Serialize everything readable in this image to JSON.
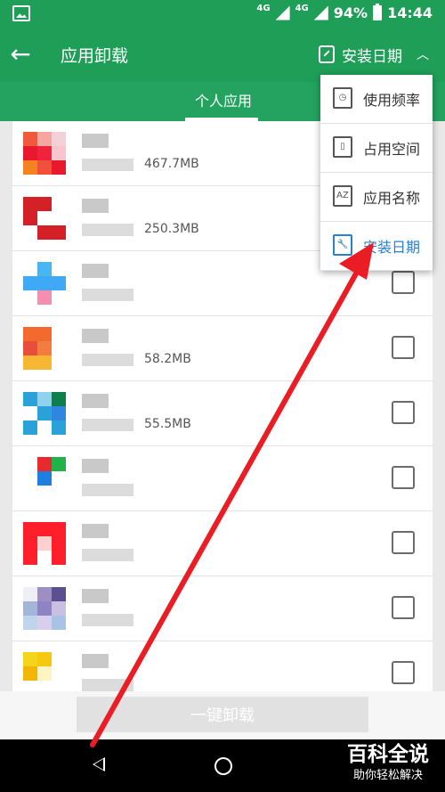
{
  "status": {
    "network1": "4G",
    "network2": "4G",
    "battery": "94%",
    "time": "14:44"
  },
  "appbar": {
    "title": "应用卸载",
    "sort_label": "安装日期"
  },
  "tabs": [
    {
      "label": "个人应用"
    }
  ],
  "apps": [
    {
      "size": "467.7MB",
      "colors": [
        "#f05a3a",
        "#f6a6a0",
        "#f4d1d6",
        "#e8192c",
        "#ef233c",
        "#f7c5cd",
        "#f58220",
        "#f24f3d",
        "#e8192c"
      ]
    },
    {
      "size": "250.3MB",
      "colors": [
        "#d42027",
        "#d42027",
        "#ffffff",
        "#d42027",
        "#ffffff",
        "#ffffff",
        "#ffffff",
        "#d42027",
        "#d42027"
      ]
    },
    {
      "size": "",
      "colors": [
        "#ffffff",
        "#49b6f4",
        "#ffffff",
        "#3fa9f5",
        "#3fa9f5",
        "#3fa9f5",
        "#ffffff",
        "#f48fb1",
        "#ffffff"
      ]
    },
    {
      "size": "58.2MB",
      "colors": [
        "#f26a2e",
        "#f26a2e",
        "#ffffff",
        "#e94e3d",
        "#f57c41",
        "#ffffff",
        "#f7b733",
        "#f7b733",
        "#ffffff"
      ]
    },
    {
      "size": "55.5MB",
      "colors": [
        "#2aa1d8",
        "#8fd1ef",
        "#0e7e4e",
        "#ffffff",
        "#2aa1d8",
        "#2e86de",
        "#2aa1d8",
        "#ffffff",
        "#2aa1d8"
      ]
    },
    {
      "size": "",
      "colors": [
        "#ffffff",
        "#e8292d",
        "#1fb34a",
        "#ffffff",
        "#1f7fe0",
        "#ffffff",
        "#ffffff",
        "#ffffff",
        "#ffffff"
      ]
    },
    {
      "size": "",
      "colors": [
        "#ff1f2a",
        "#ff1f2a",
        "#ff1f2a",
        "#ff1f2a",
        "#ffd0d0",
        "#ff1f2a",
        "#ff1f2a",
        "#ffffff",
        "#ff1f2a"
      ]
    },
    {
      "size": "",
      "colors": [
        "#eef0f6",
        "#9d8fc1",
        "#5a4f8f",
        "#a3b6d8",
        "#8e84c4",
        "#c8bfe3",
        "#c0d4ee",
        "#d8cfee",
        "#a8c3e6"
      ]
    },
    {
      "size": "",
      "colors": [
        "#f4d41b",
        "#f6c90e",
        "#ffffff",
        "#f2b705",
        "#fff4c2",
        "#ffffff",
        "#ffffff",
        "#ffffff",
        "#ffffff"
      ]
    }
  ],
  "action": {
    "uninstall_label": "一键卸载"
  },
  "menu": [
    {
      "label": "使用频率",
      "icon": "clock-icon"
    },
    {
      "label": "占用空间",
      "icon": "sdcard-icon"
    },
    {
      "label": "应用名称",
      "icon": "az-icon"
    },
    {
      "label": "安装日期",
      "icon": "wrench-icon"
    }
  ],
  "watermark": {
    "main": "百科全说",
    "sub": "助你轻松解决"
  },
  "colors": {
    "primary": "#1e9e57",
    "accent": "#2a7fd0",
    "annotation": "#ea1c24"
  }
}
